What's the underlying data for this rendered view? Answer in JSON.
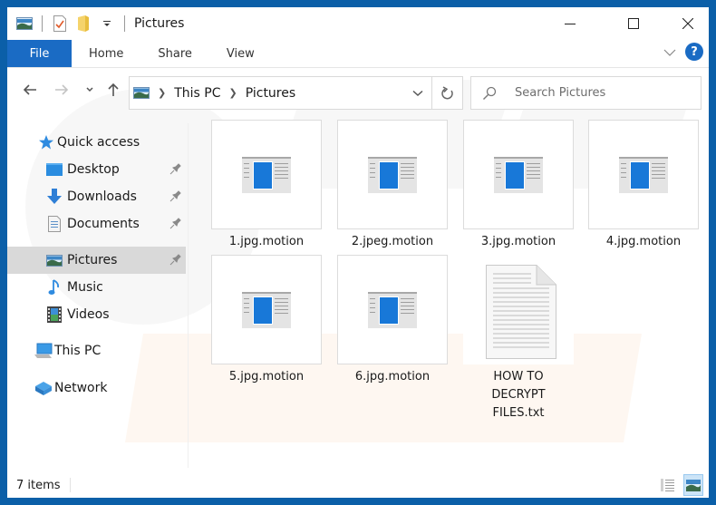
{
  "window": {
    "title": "Pictures",
    "controls": {
      "minimize": "minimize",
      "maximize": "maximize",
      "close": "close"
    }
  },
  "quick_access_toolbar": {
    "icons": [
      "pictures-icon",
      "properties-icon",
      "new-folder-icon",
      "customize-dropdown-icon"
    ]
  },
  "ribbon": {
    "tabs": [
      {
        "label": "File",
        "active": true
      },
      {
        "label": "Home"
      },
      {
        "label": "Share"
      },
      {
        "label": "View"
      }
    ],
    "help_label": "?"
  },
  "navigation": {
    "breadcrumb": [
      "This PC",
      "Pictures"
    ],
    "search_placeholder": "Search Pictures"
  },
  "sidebar": {
    "items": [
      {
        "label": "Quick access",
        "icon": "star-icon",
        "level": 0
      },
      {
        "label": "Desktop",
        "icon": "desktop-icon",
        "level": 1,
        "pinned": true
      },
      {
        "label": "Downloads",
        "icon": "download-icon",
        "level": 1,
        "pinned": true
      },
      {
        "label": "Documents",
        "icon": "documents-icon",
        "level": 1,
        "pinned": true
      },
      {
        "label": "Pictures",
        "icon": "pictures-icon",
        "level": 1,
        "pinned": true,
        "selected": true
      },
      {
        "label": "Music",
        "icon": "music-icon",
        "level": 1
      },
      {
        "label": "Videos",
        "icon": "videos-icon",
        "level": 1
      },
      {
        "label": "This PC",
        "icon": "computer-icon",
        "level": 0
      },
      {
        "label": "Network",
        "icon": "network-icon",
        "level": 0
      }
    ]
  },
  "files": [
    {
      "name": "1.jpg.motion",
      "type": "app-thumbnail"
    },
    {
      "name": "2.jpeg.motion",
      "type": "app-thumbnail"
    },
    {
      "name": "3.jpg.motion",
      "type": "app-thumbnail"
    },
    {
      "name": "4.jpg.motion",
      "type": "app-thumbnail"
    },
    {
      "name": "5.jpg.motion",
      "type": "app-thumbnail"
    },
    {
      "name": "6.jpg.motion",
      "type": "app-thumbnail"
    },
    {
      "name": "HOW TO DECRYPT FILES.txt",
      "type": "text-document"
    }
  ],
  "status_bar": {
    "item_count": "7 items",
    "views": [
      "details-view",
      "large-icons-view"
    ],
    "active_view": "large-icons-view"
  },
  "colors": {
    "frame": "#0b5fa8",
    "accent": "#1a6bc4",
    "selected_bg": "#d9d9d9"
  }
}
